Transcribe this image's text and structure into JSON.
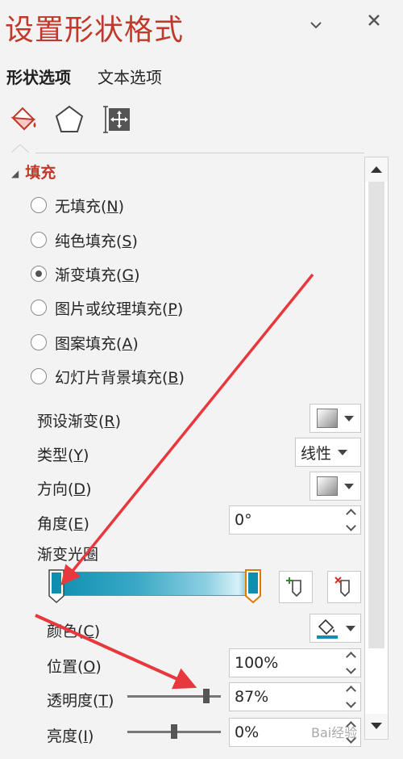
{
  "pane": {
    "title": "设置形状格式",
    "tabs": [
      "形状选项",
      "文本选项"
    ],
    "icons": [
      "fill-line-icon",
      "effects-pentagon-icon",
      "size-properties-icon"
    ]
  },
  "fill": {
    "section_title": "填充",
    "options": [
      {
        "pre": "无填充(",
        "key": "N",
        "post": ")",
        "checked": false
      },
      {
        "pre": "纯色填充(",
        "key": "S",
        "post": ")",
        "checked": false
      },
      {
        "pre": "渐变填充(",
        "key": "G",
        "post": ")",
        "checked": true
      },
      {
        "pre": "图片或纹理填充(",
        "key": "P",
        "post": ")",
        "checked": false
      },
      {
        "pre": "图案填充(",
        "key": "A",
        "post": ")",
        "checked": false
      },
      {
        "pre": "幻灯片背景填充(",
        "key": "B",
        "post": ")",
        "checked": false
      }
    ],
    "preset": {
      "pre": "预设渐变(",
      "key": "R",
      "post": ")"
    },
    "type": {
      "pre": "类型(",
      "key": "Y",
      "post": ")",
      "value": "线性"
    },
    "direction": {
      "pre": "方向(",
      "key": "D",
      "post": ")"
    },
    "angle": {
      "pre": "角度(",
      "key": "E",
      "post": ")",
      "value": "0°"
    },
    "stops_label": "渐变光圈",
    "stop_color": "#0f8fb0",
    "color": {
      "pre": "颜色(",
      "key": "C",
      "post": ")"
    },
    "position": {
      "pre": "位置(",
      "key": "O",
      "post": ")",
      "value": "100%"
    },
    "transparency": {
      "pre": "透明度(",
      "key": "T",
      "post": ")",
      "value": "87%",
      "level": 0.87
    },
    "brightness": {
      "pre": "亮度(",
      "key": "I",
      "post": ")",
      "value": "0%",
      "level": 0.5
    }
  },
  "colors": {
    "accent": "#c0392b",
    "annotation_arrow": "#e8383d"
  },
  "watermark": "Bai经验"
}
